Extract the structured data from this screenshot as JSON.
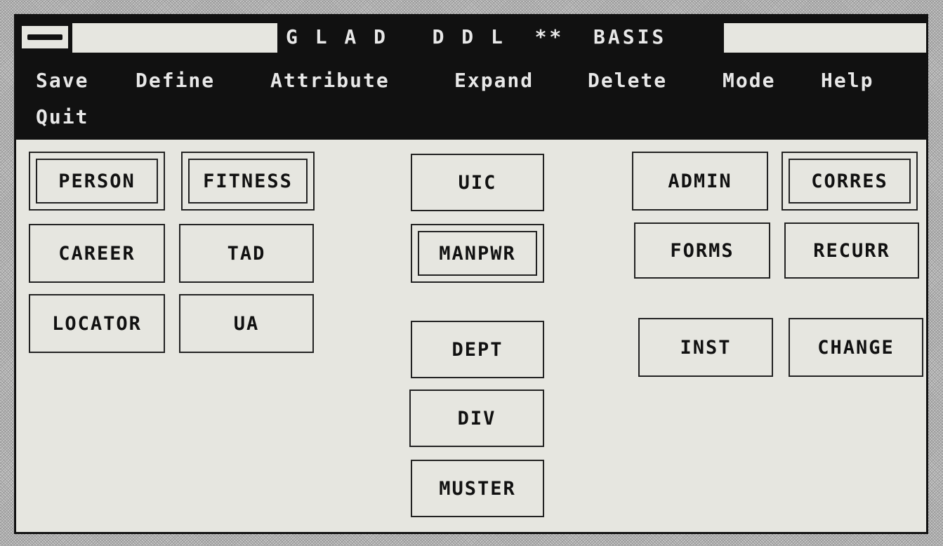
{
  "window": {
    "title": "G L A D   D D L  **  BASIS"
  },
  "menu": {
    "items": [
      "Save",
      "Define",
      "Attribute",
      "Expand",
      "Delete",
      "Mode",
      "Help",
      "Quit"
    ]
  },
  "entities": {
    "person": "PERSON",
    "fitness": "FITNESS",
    "career": "CAREER",
    "tad": "TAD",
    "locator": "LOCATOR",
    "ua": "UA",
    "uic": "UIC",
    "manpwr": "MANPWR",
    "dept": "DEPT",
    "div": "DIV",
    "muster": "MUSTER",
    "admin": "ADMIN",
    "corres": "CORRES",
    "forms": "FORMS",
    "recurr": "RECURR",
    "inst": "INST",
    "change": "CHANGE"
  }
}
